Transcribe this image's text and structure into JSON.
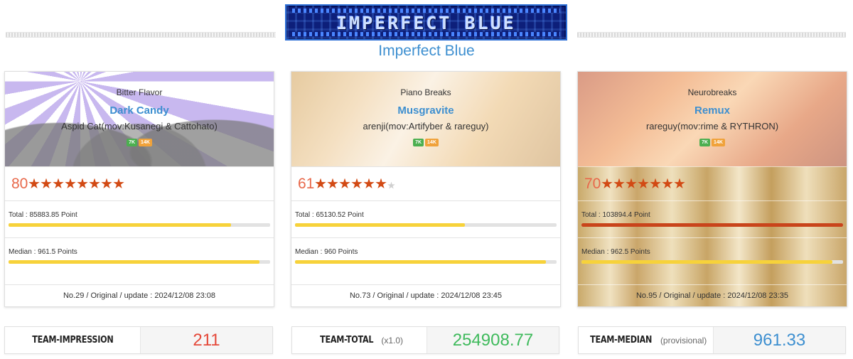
{
  "header": {
    "logo_text": "IMPERFECT BLUE",
    "title": "Imperfect Blue"
  },
  "cards": [
    {
      "genre": "Bitter Flavor",
      "title": "Dark Candy",
      "artist": "Aspid Cat(mov:Kusanegi & Cattohato)",
      "badges": [
        "7K",
        "14K"
      ],
      "rating": "80",
      "stars_filled": 8,
      "stars_total": 8,
      "total_label": "Total : 85883.85 Point",
      "total_fraction": 0.85,
      "median_label": "Median : 961.5 Points",
      "median_fraction": 0.96,
      "footer": "No.29 / Original / update : 2024/12/08 23:08"
    },
    {
      "genre": "Piano Breaks",
      "title": "Musgravite",
      "artist": "arenji(mov:Artifyber & rareguy)",
      "badges": [
        "7K",
        "14K"
      ],
      "rating": "61",
      "stars_filled": 6,
      "stars_total": 7,
      "total_label": "Total : 65130.52 Point",
      "total_fraction": 0.65,
      "median_label": "Median : 960 Points",
      "median_fraction": 0.96,
      "footer": "No.73 / Original / update : 2024/12/08 23:45"
    },
    {
      "genre": "Neurobreaks",
      "title": "Remux",
      "artist": "rareguy(mov:rime & RYTHRON)",
      "badges": [
        "7K",
        "14K"
      ],
      "rating": "70",
      "stars_filled": 7,
      "stars_total": 7,
      "total_label": "Total : 103894.4 Point",
      "total_fraction": 1.0,
      "median_label": "Median : 962.5 Points",
      "median_fraction": 0.96,
      "footer": "No.95 / Original / update : 2024/12/08 23:35"
    }
  ],
  "team": {
    "impression": {
      "label": "TEAM-IMPRESSION",
      "sub": "",
      "value": "211"
    },
    "total": {
      "label": "TEAM-TOTAL",
      "sub": "(x1.0)",
      "value": "254908.77"
    },
    "median": {
      "label": "TEAM-MEDIAN",
      "sub": "(provisional)",
      "value": "961.33"
    }
  },
  "colors": {
    "accent_blue": "#3d8fd0",
    "star": "#d24a14",
    "bar_yellow": "#f7d23a",
    "bar_red": "#c9441b",
    "impression_red": "#e5493a",
    "total_green": "#3fba5c"
  }
}
